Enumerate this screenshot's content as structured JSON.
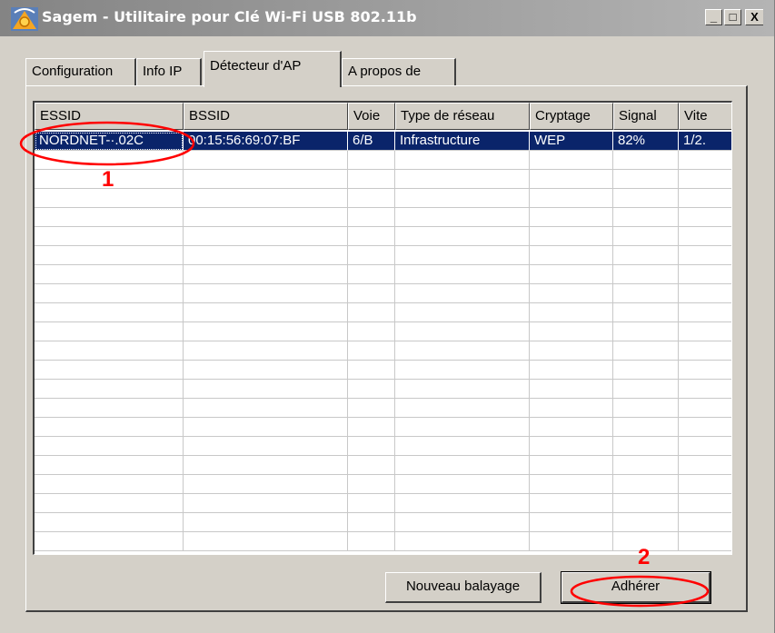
{
  "window": {
    "title": "Sagem - Utilitaire pour Clé Wi-Fi USB 802.11b",
    "minimize_label": "_",
    "maximize_label": "□",
    "close_label": "X"
  },
  "tabs": [
    {
      "label": "Configuration"
    },
    {
      "label": "Info IP"
    },
    {
      "label": "Détecteur d'AP"
    },
    {
      "label": "A propos de"
    }
  ],
  "active_tab": "Détecteur d'AP",
  "table": {
    "columns": [
      "ESSID",
      "BSSID",
      "Voie",
      "Type de réseau",
      "Cryptage",
      "Signal",
      "Vite"
    ],
    "rows": [
      [
        "NORDNET-·.02C",
        "00:15:56:69:07:BF",
        "6/B",
        "Infrastructure",
        "WEP",
        "82%",
        "1/2."
      ]
    ]
  },
  "buttons": {
    "rescan": "Nouveau balayage",
    "join": "Adhérer"
  },
  "annotations": {
    "step1": "1",
    "step2": "2",
    "color": "#ff0000"
  },
  "colors": {
    "selection": "#0a246a",
    "face": "#d4d0c8"
  }
}
